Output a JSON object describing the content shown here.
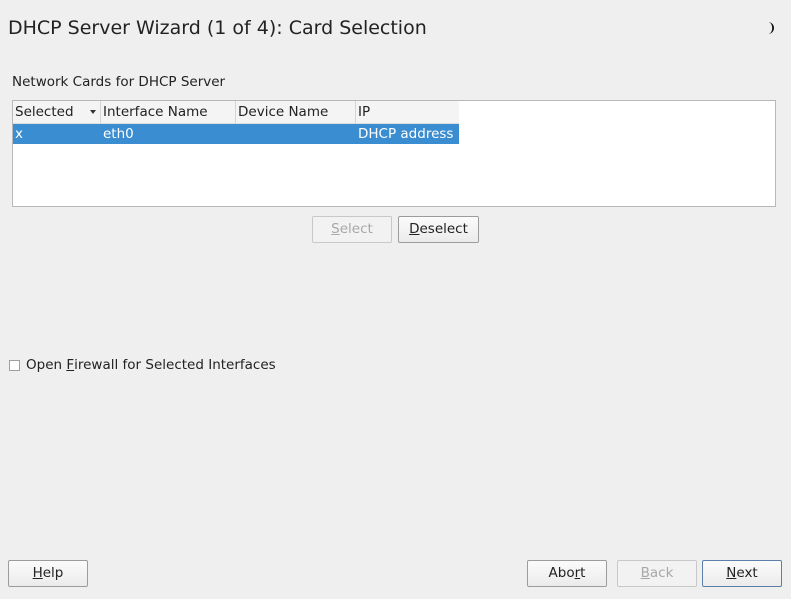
{
  "window": {
    "title": "DHCP Server Wizard (1 of 4): Card Selection",
    "logo_icon": "moon-logo-icon"
  },
  "cards": {
    "section_label": "Network Cards for DHCP Server",
    "columns": [
      "Selected",
      "Interface Name",
      "Device Name",
      "IP"
    ],
    "sort_column": "Selected",
    "rows": [
      {
        "selected": "x",
        "interface_name": "eth0",
        "device_name": "",
        "ip": "DHCP address"
      }
    ],
    "selected_row_color": "#3a8dd0",
    "select_button": {
      "pre": "",
      "mnemonic": "S",
      "post": "elect"
    },
    "deselect_button": {
      "pre": "",
      "mnemonic": "D",
      "post": "eselect"
    }
  },
  "firewall": {
    "checked": false,
    "label_pre": "Open ",
    "label_mnemonic": "F",
    "label_post": "irewall for Selected Interfaces"
  },
  "footer": {
    "help": {
      "pre": "",
      "mnemonic": "H",
      "post": "elp"
    },
    "abort": {
      "pre": "Abo",
      "mnemonic": "r",
      "post": "t"
    },
    "back": {
      "pre": "",
      "mnemonic": "B",
      "post": "ack"
    },
    "next": {
      "pre": "",
      "mnemonic": "N",
      "post": "ext"
    }
  }
}
